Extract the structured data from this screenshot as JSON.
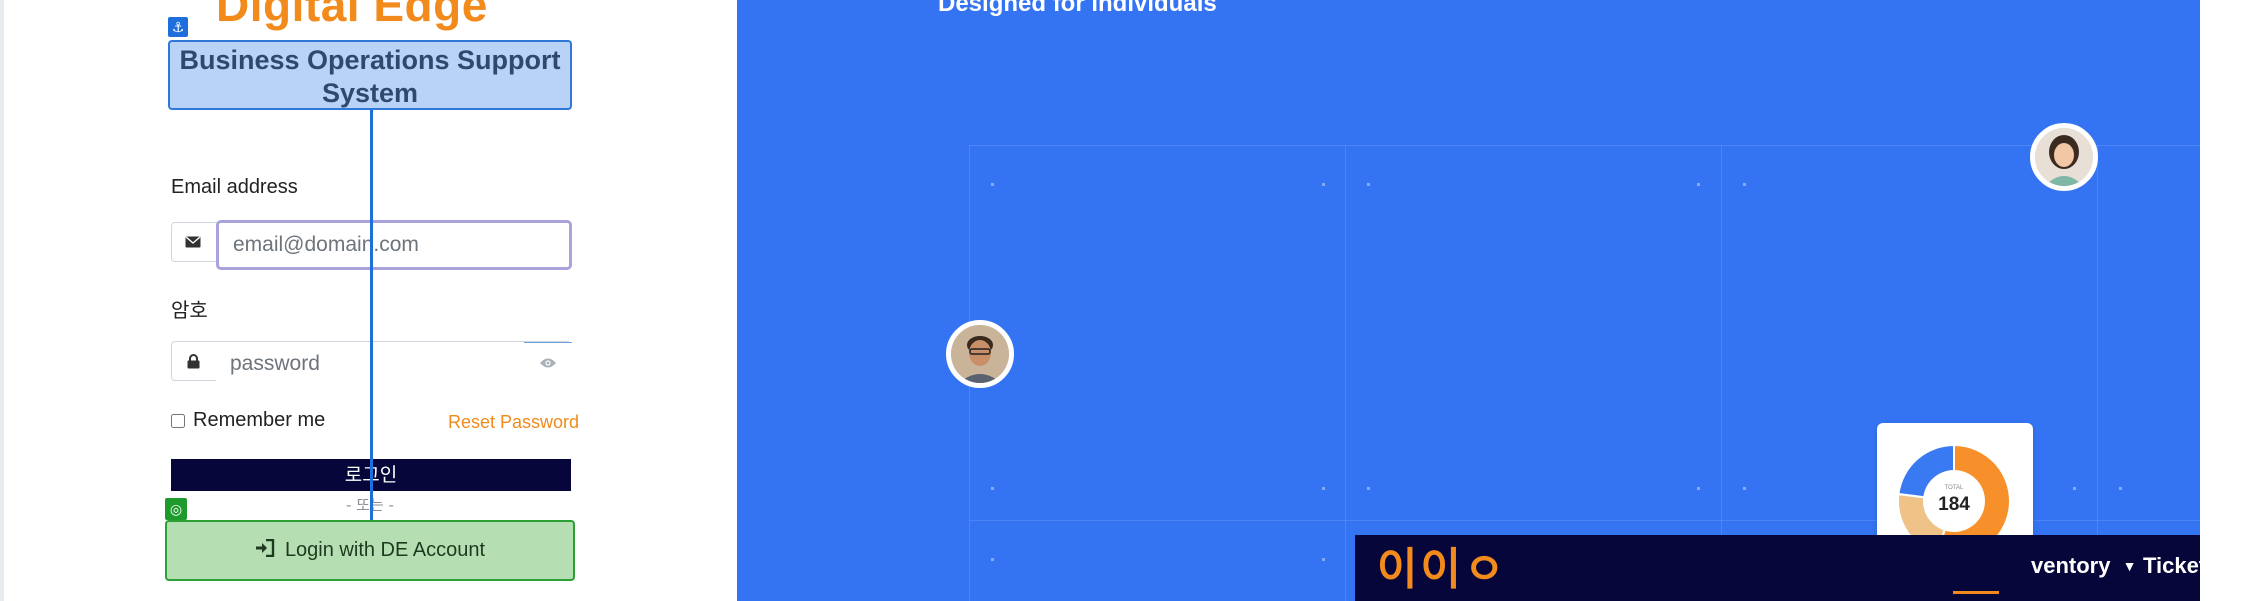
{
  "brand": {
    "name": "Digital Edge",
    "subtitle": "Business Operations Support System"
  },
  "form": {
    "email_label": "Email address",
    "email_placeholder": "email@domain.com",
    "password_label": "암호",
    "password_placeholder": "password",
    "remember_label": "Remember me",
    "reset_label": "Reset Password",
    "login_label": "로그인",
    "or_label": "- 또는 -",
    "de_login_label": "Login with DE Account"
  },
  "hero": {
    "tagline": "Designed for individuals",
    "stat_caption": "TOTAL",
    "stat_value": "184",
    "donut_segments": [
      {
        "fraction": 0.55,
        "color": "#f7902a"
      },
      {
        "fraction": 0.22,
        "color": "#efc388"
      },
      {
        "fraction": 0.23,
        "color": "#3979f2"
      }
    ],
    "nav_logo": "이이ㅇ",
    "nav_items": [
      "ventory",
      "Ticket"
    ]
  },
  "icons": {
    "anchor": "anchor-icon",
    "envelope": "envelope-icon",
    "lock": "lock-icon",
    "eye": "eye-icon",
    "login": "sign-in-icon",
    "target": "target-icon",
    "caret": "caret-down-icon"
  },
  "colors": {
    "accent": "#f28a1c",
    "hero_bg": "#3474f2",
    "navy": "#06063a",
    "highlight_blue": "#2f77d8",
    "highlight_green": "#2aa035"
  }
}
